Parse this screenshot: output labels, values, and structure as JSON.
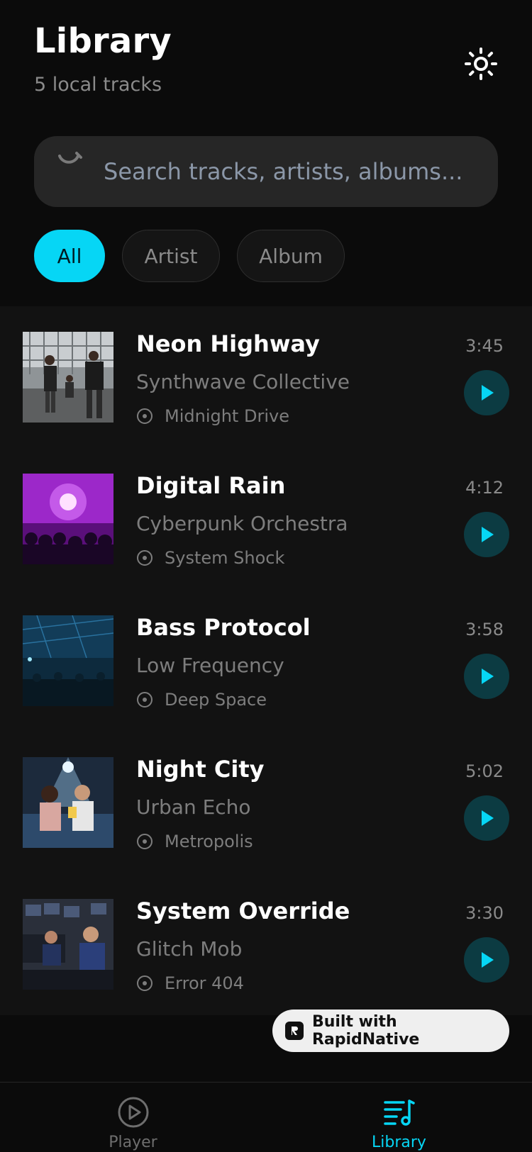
{
  "header": {
    "title": "Library",
    "subtitle": "5 local tracks",
    "theme_icon": "sun-icon"
  },
  "search": {
    "placeholder": "Search tracks, artists, albums...",
    "value": "",
    "icon": "search-icon"
  },
  "filters": [
    {
      "label": "All",
      "active": true
    },
    {
      "label": "Artist",
      "active": false
    },
    {
      "label": "Album",
      "active": false
    }
  ],
  "tracks": [
    {
      "title": "Neon Highway",
      "artist": "Synthwave Collective",
      "album": "Midnight Drive",
      "duration": "3:45"
    },
    {
      "title": "Digital Rain",
      "artist": "Cyberpunk Orchestra",
      "album": "System Shock",
      "duration": "4:12"
    },
    {
      "title": "Bass Protocol",
      "artist": "Low Frequency",
      "album": "Deep Space",
      "duration": "3:58"
    },
    {
      "title": "Night City",
      "artist": "Urban Echo",
      "album": "Metropolis",
      "duration": "5:02"
    },
    {
      "title": "System Override",
      "artist": "Glitch Mob",
      "album": "Error 404",
      "duration": "3:30"
    }
  ],
  "badge": {
    "text": "Built with RapidNative"
  },
  "nav": {
    "player": {
      "label": "Player",
      "icon": "play-circle-icon"
    },
    "library": {
      "label": "Library",
      "icon": "music-list-icon",
      "active": true
    }
  },
  "colors": {
    "accent": "#06d6f5",
    "background": "#0b0b0b",
    "list_background": "#121212",
    "play_button_bg": "#0c3b42"
  }
}
